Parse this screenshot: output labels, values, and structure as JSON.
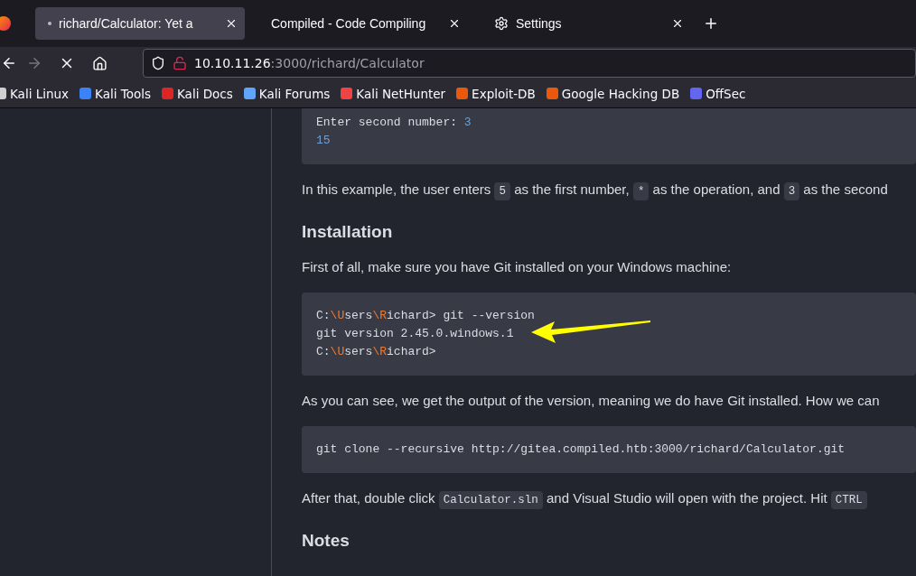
{
  "tabs": [
    {
      "label": "richard/Calculator: Yet a",
      "selected": true
    },
    {
      "label": "Compiled - Code Compiling",
      "selected": false
    },
    {
      "label": "Settings",
      "selected": false
    }
  ],
  "nav": {
    "url_host": "10.10.11.26",
    "url_path": ":3000/richard/Calculator",
    "loading": true
  },
  "bookmarks": [
    {
      "label": "Kali Linux",
      "color": "#d0d0d0"
    },
    {
      "label": "Kali Tools",
      "color": "#3b82f6"
    },
    {
      "label": "Kali Docs",
      "color": "#dc2626"
    },
    {
      "label": "Kali Forums",
      "color": "#60a5fa"
    },
    {
      "label": "Kali NetHunter",
      "color": "#ef4444"
    },
    {
      "label": "Exploit-DB",
      "color": "#ea580c"
    },
    {
      "label": "Google Hacking DB",
      "color": "#ea580c"
    },
    {
      "label": "OffSec",
      "color": "#6366f1"
    }
  ],
  "content": [
    {
      "kind": "code",
      "lines": [
        [
          {
            "text": "Enter second number: ",
            "kind": "plain"
          },
          {
            "text": "3",
            "kind": "number"
          }
        ],
        [
          {
            "text": "15",
            "kind": "number"
          }
        ]
      ]
    },
    {
      "kind": "paragraph",
      "segments": [
        {
          "text": "In this example, the user enters ",
          "kind": "text"
        },
        {
          "text": "5",
          "kind": "code"
        },
        {
          "text": " as the first number, ",
          "kind": "text"
        },
        {
          "text": "*",
          "kind": "code"
        },
        {
          "text": " as the operation, and ",
          "kind": "text"
        },
        {
          "text": "3",
          "kind": "code"
        },
        {
          "text": " as the second",
          "kind": "text"
        }
      ]
    },
    {
      "kind": "heading",
      "text": "Installation"
    },
    {
      "kind": "paragraph",
      "segments": [
        {
          "text": "First of all, make sure you have Git installed on your Windows machine:",
          "kind": "text"
        }
      ]
    },
    {
      "kind": "code",
      "arrow": true,
      "lines": [
        [
          {
            "text": "C:",
            "kind": "plain"
          },
          {
            "text": "\\U",
            "kind": "escape"
          },
          {
            "text": "sers",
            "kind": "plain"
          },
          {
            "text": "\\R",
            "kind": "escape"
          },
          {
            "text": "ichard> git --version",
            "kind": "plain"
          }
        ],
        [
          {
            "text": "git version 2.45.0.windows.1",
            "kind": "plain"
          }
        ],
        [
          {
            "text": "C:",
            "kind": "plain"
          },
          {
            "text": "\\U",
            "kind": "escape"
          },
          {
            "text": "sers",
            "kind": "plain"
          },
          {
            "text": "\\R",
            "kind": "escape"
          },
          {
            "text": "ichard>",
            "kind": "plain"
          }
        ]
      ]
    },
    {
      "kind": "paragraph",
      "segments": [
        {
          "text": "As you can see, we get the output of the version, meaning we do have Git installed. How we can",
          "kind": "text"
        }
      ]
    },
    {
      "kind": "code",
      "lines": [
        [
          {
            "text": "git clone --recursive http://gitea.compiled.htb:3000/richard/Calculator.git",
            "kind": "plain"
          }
        ]
      ]
    },
    {
      "kind": "paragraph",
      "segments": [
        {
          "text": "After that, double click ",
          "kind": "text"
        },
        {
          "text": "Calculator.sln",
          "kind": "code"
        },
        {
          "text": " and Visual Studio will open with the project. Hit ",
          "kind": "text"
        },
        {
          "text": "CTRL",
          "kind": "code"
        }
      ]
    },
    {
      "kind": "heading",
      "text": "Notes"
    }
  ]
}
